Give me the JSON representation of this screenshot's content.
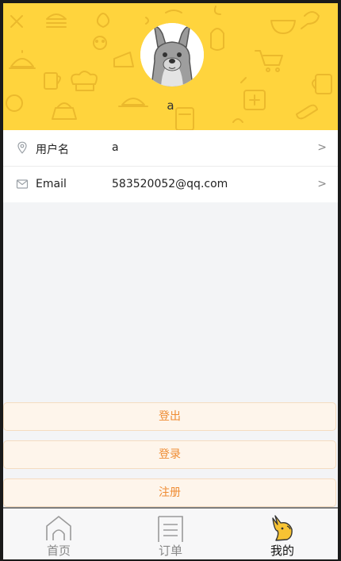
{
  "colors": {
    "header_bg": "#ffd43d",
    "accent_text": "#ef8c33",
    "button_bg": "#fef5eb",
    "page_bg": "#f3f4f6"
  },
  "profile": {
    "avatar_icon": "kangaroo-avatar-icon",
    "nickname": "a"
  },
  "info_rows": [
    {
      "icon": "location-pin-icon",
      "label": "用户名",
      "value": "a",
      "arrow": ">"
    },
    {
      "icon": "mail-icon",
      "label": "Email",
      "value": "583520052@qq.com",
      "arrow": ">"
    }
  ],
  "actions": {
    "logout": "登出",
    "login": "登录",
    "register": "注册"
  },
  "tabbar": [
    {
      "icon": "home-icon",
      "label": "首页",
      "active": false
    },
    {
      "icon": "order-list-icon",
      "label": "订单",
      "active": false
    },
    {
      "icon": "kangaroo-icon",
      "label": "我的",
      "active": true
    }
  ]
}
